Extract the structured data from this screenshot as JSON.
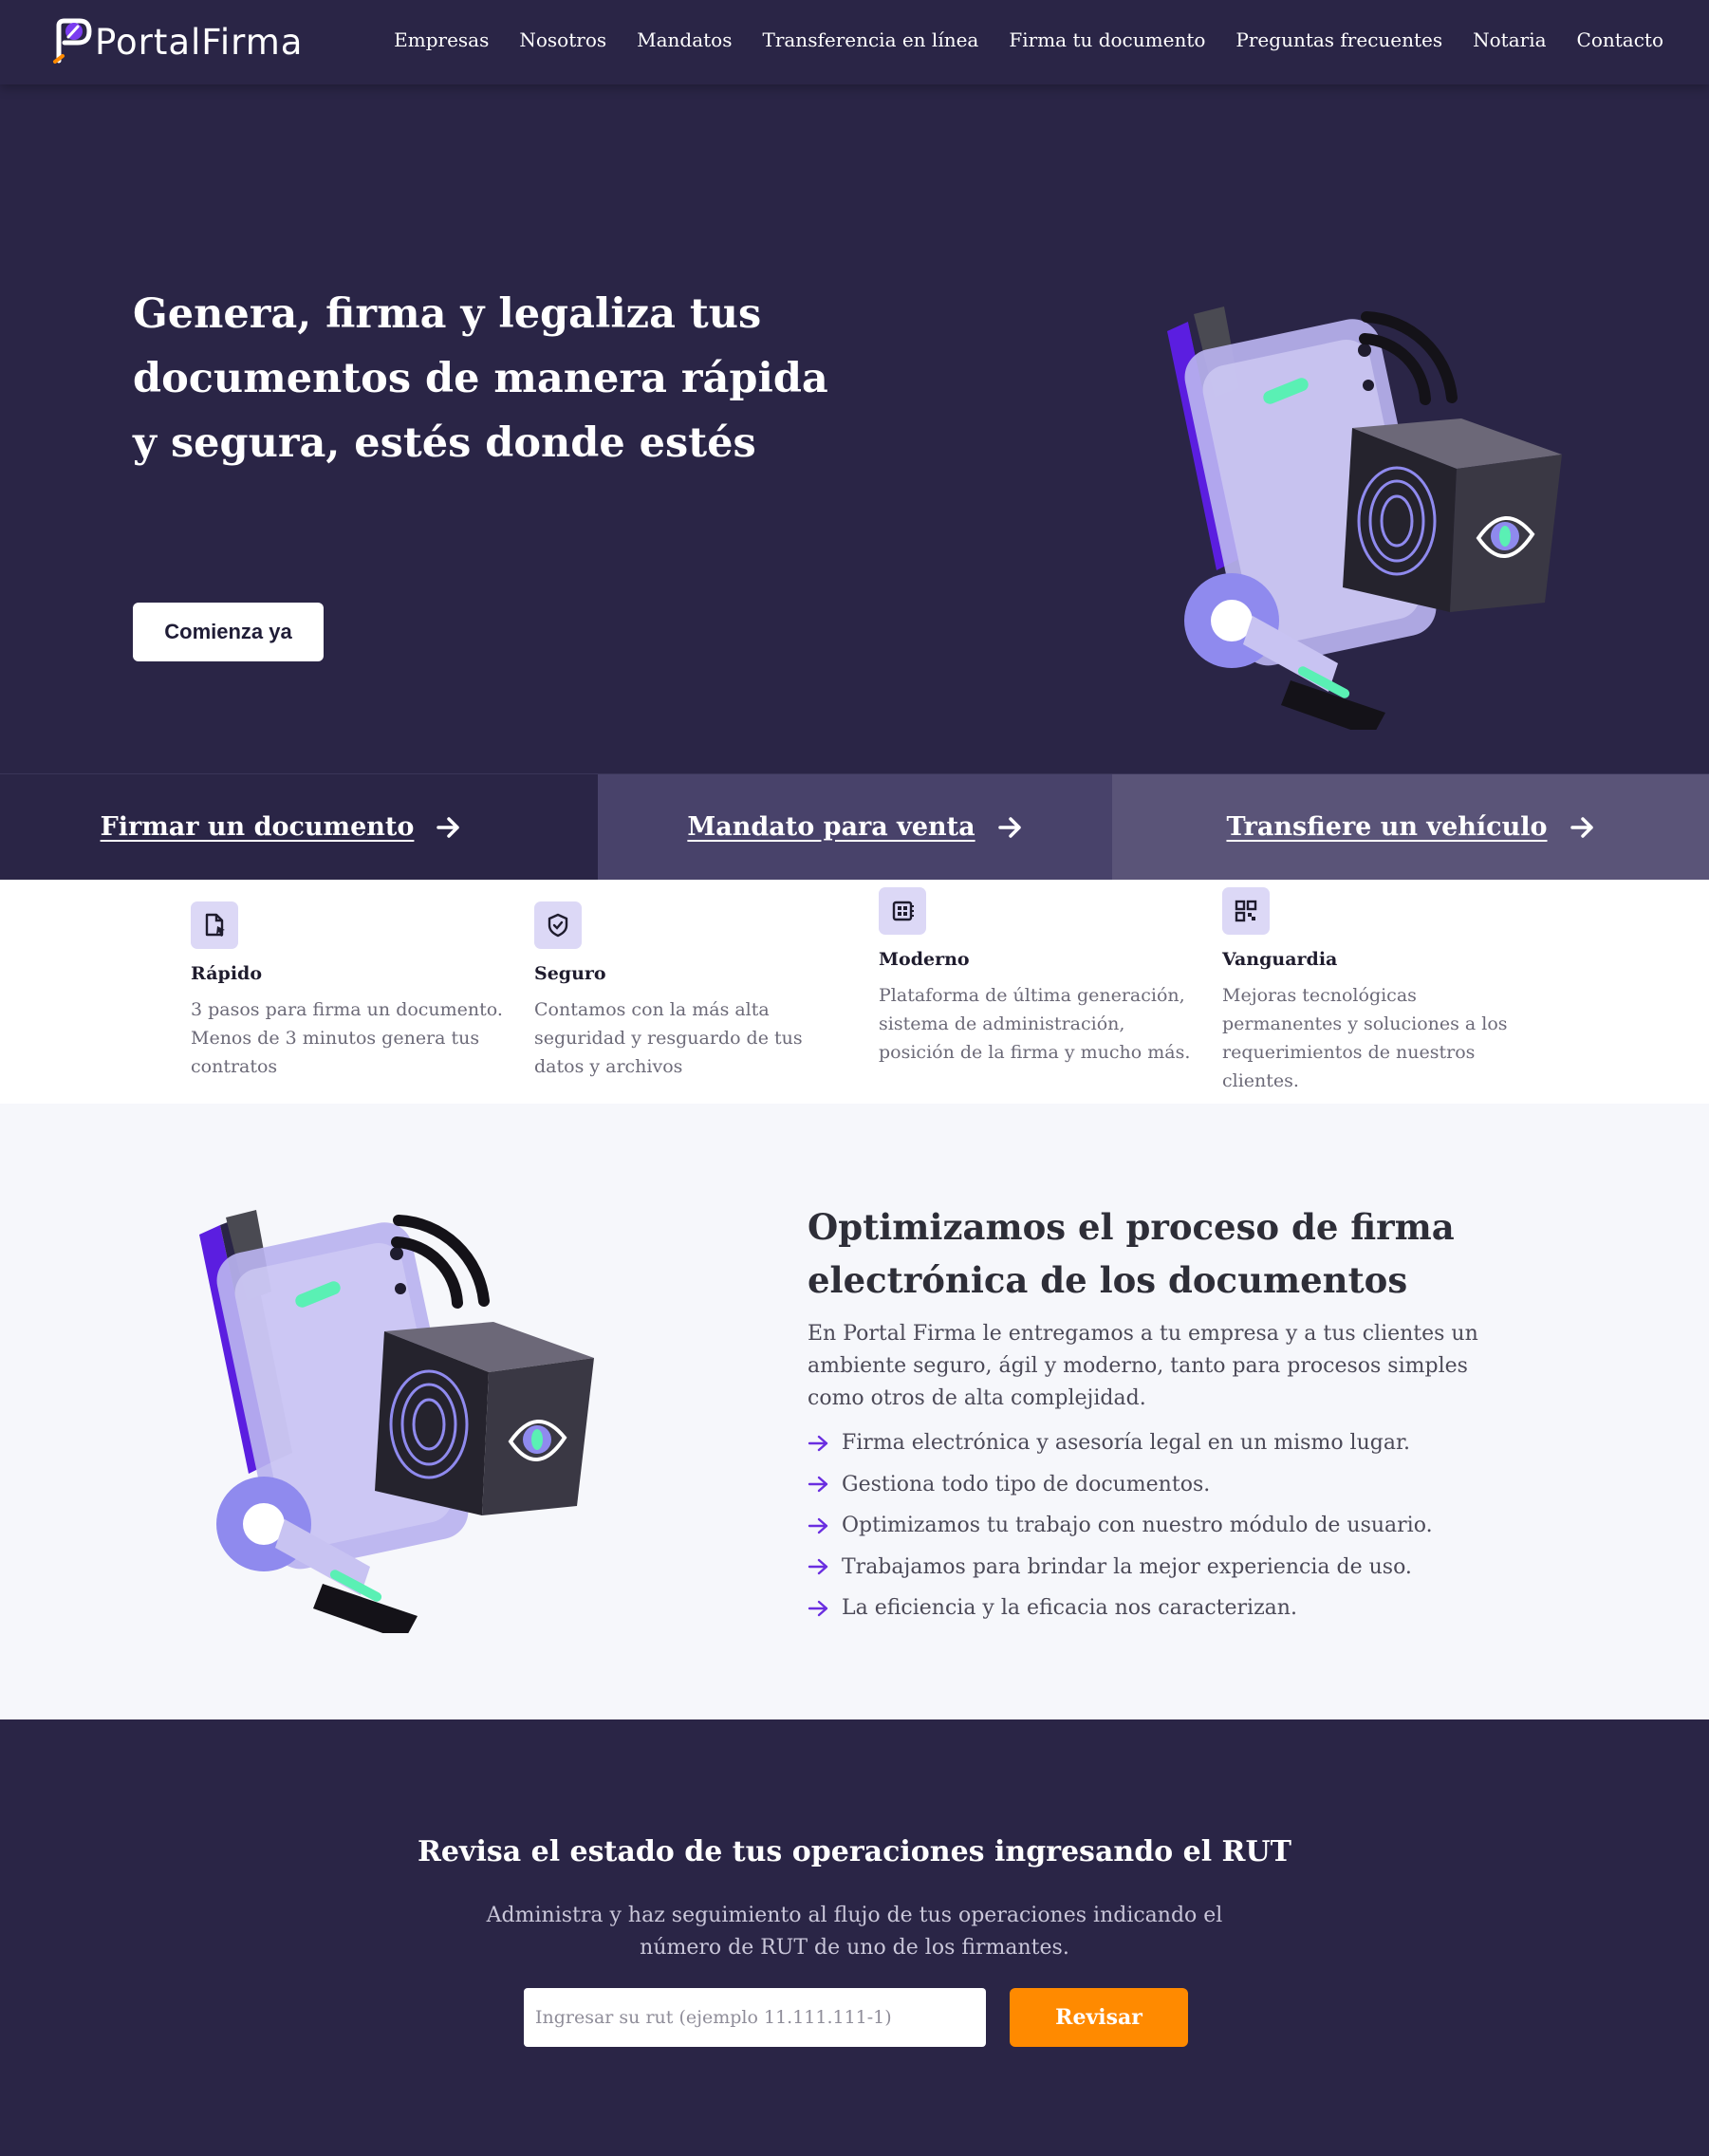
{
  "brand": {
    "name": "PortalFirma",
    "logo_icon": "signature-pen-logo"
  },
  "nav": {
    "items": [
      {
        "label": "Empresas"
      },
      {
        "label": "Nosotros"
      },
      {
        "label": "Mandatos"
      },
      {
        "label": "Transferencia en línea"
      },
      {
        "label": "Firma tu documento"
      },
      {
        "label": "Preguntas frecuentes"
      },
      {
        "label": "Notaria"
      },
      {
        "label": "Contacto"
      }
    ]
  },
  "hero": {
    "title": "Genera, firma y legaliza tus documentos de manera rápida y segura, estés donde estés",
    "cta_label": "Comienza ya",
    "illustration": "secure-device-fingerprint-illustration"
  },
  "actions": [
    {
      "label": "Firmar un documento",
      "icon": "arrow-right-icon"
    },
    {
      "label": "Mandato para venta",
      "icon": "arrow-right-icon"
    },
    {
      "label": "Transfiere un vehículo",
      "icon": "arrow-right-icon"
    }
  ],
  "features": [
    {
      "title": "Rápido",
      "text": "3 pasos para firma un documento. Menos de 3 minutos genera tus contratos",
      "icon": "document-cursor-icon"
    },
    {
      "title": "Seguro",
      "text": "Contamos con la más alta seguridad y resguardo de tus datos y archivos",
      "icon": "shield-check-icon"
    },
    {
      "title": "Moderno",
      "text": "Plataforma de última generación, sistema de administración, posición de la firma y mucho más.",
      "icon": "chip-icon"
    },
    {
      "title": "Vanguardia",
      "text": "Mejoras tecnológicas permanentes y soluciones a los requerimientos de nuestros clientes.",
      "icon": "qr-code-icon"
    }
  ],
  "optimize": {
    "title": "Optimizamos el proceso de firma electrónica de los documentos",
    "description": "En Portal Firma le entregamos a tu empresa y a tus clientes un ambiente seguro, ágil y moderno, tanto para procesos simples como otros de alta complejidad.",
    "bullets": [
      "Firma electrónica y asesoría legal en un mismo lugar.",
      "Gestiona todo tipo de documentos.",
      "Optimizamos tu trabajo con nuestro módulo de usuario.",
      "Trabajamos para brindar la mejor experiencia de uso.",
      "La eficiencia y la eficacia nos caracterizan."
    ]
  },
  "rut": {
    "title": "Revisa el estado de tus operaciones ingresando el RUT",
    "description": "Administra y haz seguimiento al flujo de tus operaciones indicando el número de RUT de uno de los firmantes.",
    "input_placeholder": "Ingresar su rut (ejemplo 11.111.111-1)",
    "input_value": "",
    "button_label": "Revisar"
  },
  "colors": {
    "primary_dark": "#2a2546",
    "accent_orange": "#ff8a00",
    "accent_purple": "#6a2ee0",
    "icon_bg": "#dcd8f6"
  }
}
